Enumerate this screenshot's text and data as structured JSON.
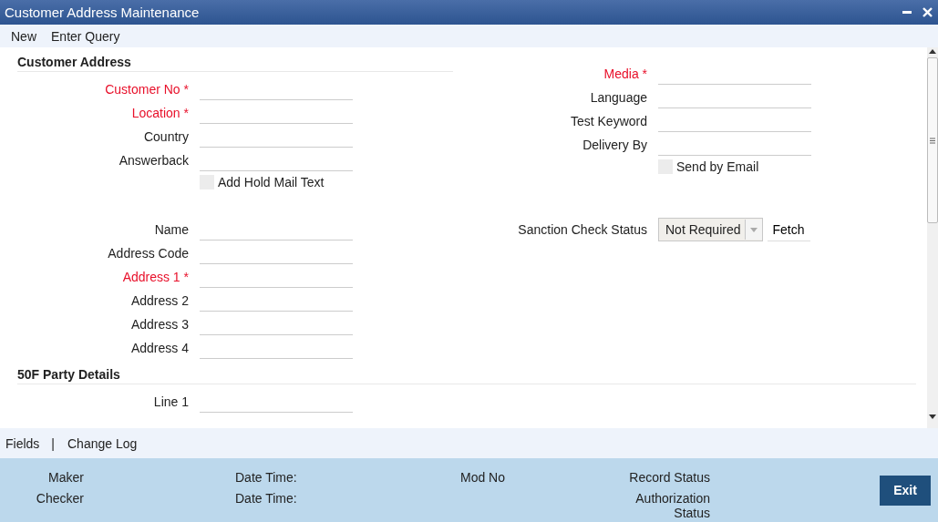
{
  "window": {
    "title": "Customer Address Maintenance"
  },
  "toolbar": [
    "New",
    "Enter Query"
  ],
  "customer_address": {
    "title": "Customer Address",
    "left_fields": [
      {
        "kind": "text",
        "label": "Customer No *",
        "required": true
      },
      {
        "kind": "text",
        "label": "Location *",
        "required": true
      },
      {
        "kind": "text",
        "label": "Country",
        "required": false
      },
      {
        "kind": "text",
        "label": "Answerback",
        "required": false
      },
      {
        "kind": "checkbox",
        "label": "Add Hold Mail Text",
        "checked": false
      }
    ],
    "right_fields": [
      {
        "kind": "text",
        "label": "Media *",
        "required": true
      },
      {
        "kind": "text",
        "label": "Language",
        "required": false
      },
      {
        "kind": "text",
        "label": "Test Keyword",
        "required": false
      },
      {
        "kind": "text",
        "label": "Delivery By",
        "required": false
      },
      {
        "kind": "checkbox",
        "label": "Send by Email",
        "checked": false
      }
    ],
    "address_fields": [
      {
        "kind": "text",
        "label": "Name",
        "required": false
      },
      {
        "kind": "text",
        "label": "Address Code",
        "required": false
      },
      {
        "kind": "text",
        "label": "Address 1 *",
        "required": true
      },
      {
        "kind": "text",
        "label": "Address 2",
        "required": false
      },
      {
        "kind": "text",
        "label": "Address 3",
        "required": false
      },
      {
        "kind": "text",
        "label": "Address 4",
        "required": false
      }
    ],
    "sanction": {
      "label": "Sanction Check Status",
      "value": "Not Required",
      "button": "Fetch"
    }
  },
  "party_details": {
    "title": "50F Party Details",
    "fields": [
      {
        "kind": "text",
        "label": "Line 1",
        "required": false
      }
    ]
  },
  "bottom_links": {
    "items": [
      "Fields",
      "Change Log"
    ],
    "separator": "|"
  },
  "footer": {
    "rows": [
      {
        "user_label": "Maker",
        "date_label": "Date Time:",
        "mod_label": "Mod No",
        "status_label": "Record Status"
      },
      {
        "user_label": "Checker",
        "date_label": "Date Time:",
        "status_label": "Authorization Status"
      }
    ],
    "exit_button": "Exit"
  }
}
